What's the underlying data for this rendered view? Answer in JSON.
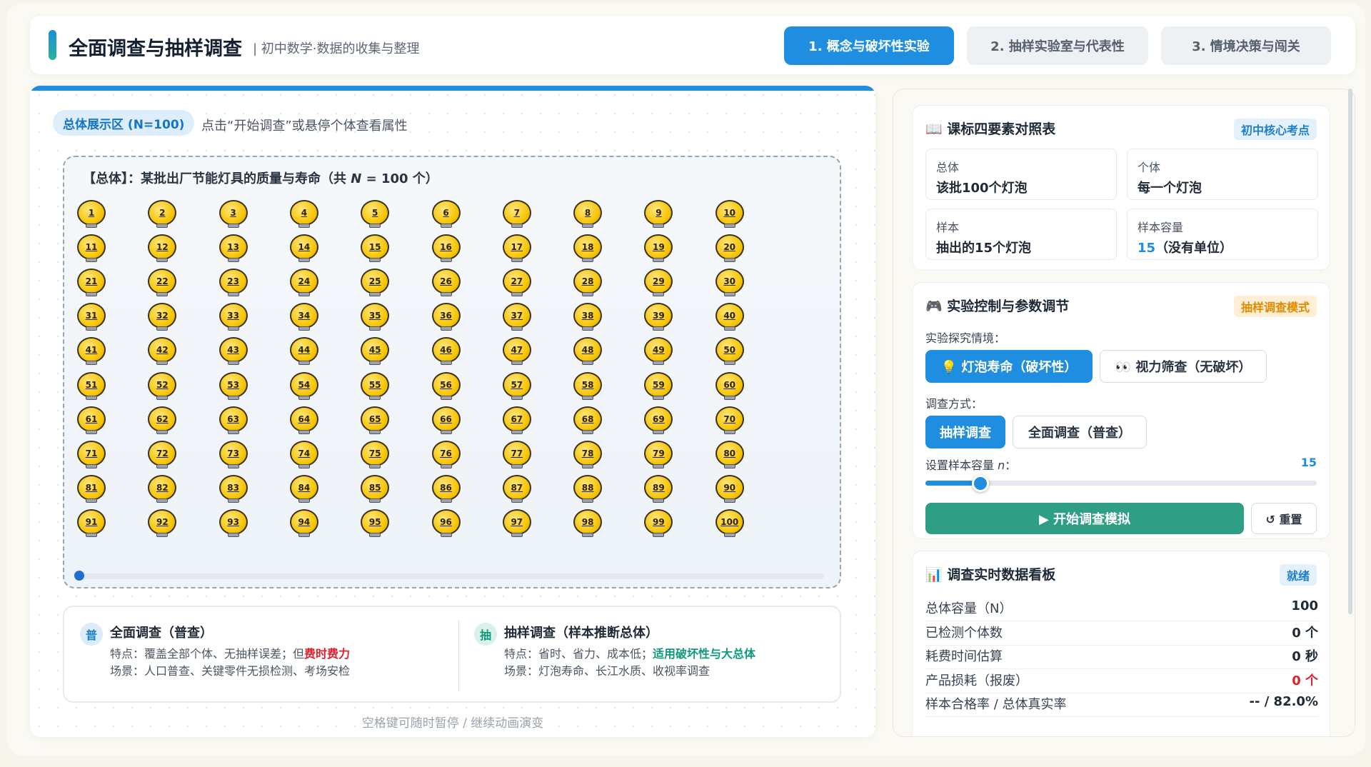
{
  "header": {
    "title": "全面调查与抽样调查",
    "subtitle": "| 初中数学·数据的收集与整理",
    "tabs": [
      {
        "label": "1. 概念与破坏性实验",
        "active": true
      },
      {
        "label": "2. 抽样实验室与代表性",
        "active": false
      },
      {
        "label": "3. 情境决策与闯关",
        "active": false
      }
    ]
  },
  "population": {
    "badge": "总体展示区 (N=100)",
    "hint": "点击“开始调查”或悬停个体查看属性",
    "title_prefix": "【总体】：某批出厂节能灯具的质量与寿命（共 ",
    "title_n": "N",
    "title_suffix": " = 100 个）",
    "count": 100,
    "scroll_progress": 0.0
  },
  "comparison": {
    "census": {
      "icon": "普",
      "title": "全面调查（普查）",
      "feature_prefix": "特点：覆盖全部个体、无抽样误差；但",
      "feature_highlight": "费时费力",
      "scene": "场景：人口普查、关键零件无损检测、考场安检"
    },
    "sample": {
      "icon": "抽",
      "title": "抽样调查（样本推断总体）",
      "feature_prefix": "特点：省时、省力、成本低；",
      "feature_highlight": "适用破坏性与大总体",
      "scene": "场景：灯泡寿命、长江水质、收视率调查"
    }
  },
  "footnote": "空格键可随时暂停 / 继续动画演变",
  "elements_card": {
    "title": "📖 课标四要素对照表",
    "tag": "初中核心考点",
    "cells": [
      {
        "key": "总体",
        "value": "该批100个灯泡"
      },
      {
        "key": "个体",
        "value": "每一个灯泡"
      },
      {
        "key": "样本",
        "value": "抽出的15个灯泡"
      },
      {
        "key": "样本容量",
        "value_num": "15",
        "value_rest": "（没有单位）"
      }
    ]
  },
  "control_card": {
    "title": "🎮 实验控制与参数调节",
    "tag": "抽样调查模式",
    "scene_label": "实验探究情境：",
    "scene_options": [
      {
        "label": "💡 灯泡寿命（破坏性）",
        "active": true
      },
      {
        "label": "👀 视力筛查（无破坏）",
        "active": false
      }
    ],
    "method_label": "调查方式：",
    "method_options": [
      {
        "label": "抽样调查",
        "active": true
      },
      {
        "label": "全面调查（普查）",
        "active": false
      }
    ],
    "sample_label": "设置样本容量 ",
    "sample_var": "n",
    "sample_label_end": "：",
    "sample_value": "15",
    "slider_fraction": 0.14,
    "start_button": "▶ 开始调查模拟",
    "reset_button": "↺ 重置"
  },
  "stats_card": {
    "title": "📊 调查实时数据看板",
    "tag": "就绪",
    "rows": [
      {
        "key": "总体容量（N）",
        "value": "100"
      },
      {
        "key": "已检测个体数",
        "value": "0 个"
      },
      {
        "key": "耗费时间估算",
        "value": "0 秒"
      },
      {
        "key": "产品损耗（报废）",
        "value": "0 个",
        "alert": true
      },
      {
        "key": "样本合格率 / 总体真实率",
        "value": "-- / 82.0%"
      }
    ]
  },
  "colors": {
    "primary": "#1f8de0",
    "teal": "#2e9f84",
    "alert": "#e0202a",
    "highlight_green": "#0f9a7a",
    "bulb": "#f5c400"
  }
}
